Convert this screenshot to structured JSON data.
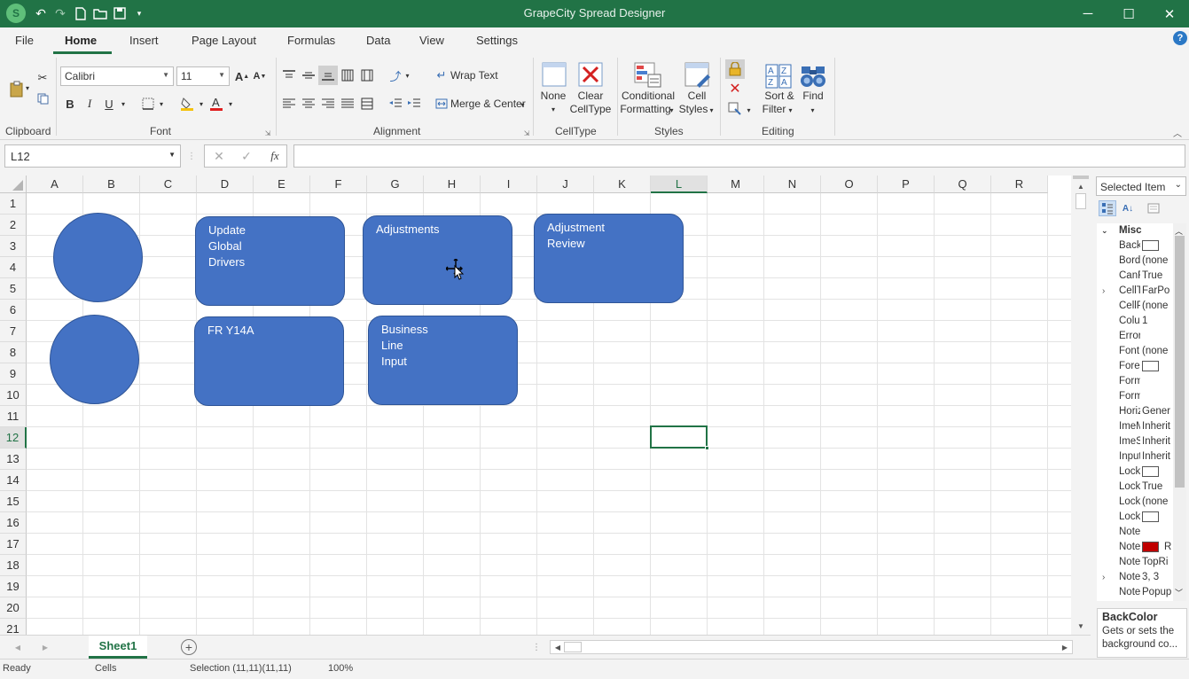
{
  "app": {
    "title": "GrapeCity Spread Designer"
  },
  "menu": {
    "tabs": [
      "File",
      "Home",
      "Insert",
      "Page Layout",
      "Formulas",
      "Data",
      "View",
      "Settings"
    ],
    "active": "Home"
  },
  "ribbon": {
    "font_name": "Calibri",
    "font_size": "11",
    "wrap_text": "Wrap Text",
    "merge_center": "Merge & Center",
    "none": "None",
    "clear_celltype_1": "Clear",
    "clear_celltype_2": "CellType",
    "conditional_1": "Conditional",
    "conditional_2": "Formatting",
    "cell_styles_1": "Cell",
    "cell_styles_2": "Styles",
    "sort_1": "Sort &",
    "sort_2": "Filter",
    "find": "Find",
    "bold": "B",
    "italic": "I",
    "underline": "U",
    "groups": {
      "clipboard": "Clipboard",
      "font": "Font",
      "alignment": "Alignment",
      "celltype": "CellType",
      "styles": "Styles",
      "editing": "Editing"
    }
  },
  "formula_bar": {
    "name_box": "L12",
    "fx": "fx",
    "formula": ""
  },
  "grid": {
    "columns": [
      "A",
      "B",
      "C",
      "D",
      "E",
      "F",
      "G",
      "H",
      "I",
      "J",
      "K",
      "L",
      "M",
      "N",
      "O",
      "P",
      "Q",
      "R"
    ],
    "rows": [
      "1",
      "2",
      "3",
      "4",
      "5",
      "6",
      "7",
      "8",
      "9",
      "10",
      "11",
      "12",
      "13",
      "14",
      "15",
      "16",
      "17",
      "18",
      "19",
      "20",
      "21"
    ],
    "selected_column": "L",
    "selected_row": "12"
  },
  "shapes": {
    "update_global": "Update\nGlobal\nDrivers",
    "adjustments": "Adjustments",
    "adjustment_review": "Adjustment\nReview",
    "fr_y14a": "FR Y14A",
    "business_line": "Business\nLine\nInput"
  },
  "sheet_tab": {
    "name": "Sheet1"
  },
  "status": {
    "ready": "Ready",
    "mode": "Cells",
    "selection": "Selection (11,11)(11,11)",
    "zoom": "100%"
  },
  "properties": {
    "selector": "Selected Item",
    "category": "Misc",
    "rows": [
      {
        "name": "BackColor",
        "value": "",
        "swatch": "#ffffff"
      },
      {
        "name": "Border",
        "value": "(none"
      },
      {
        "name": "CanFocus",
        "value": "True"
      },
      {
        "name": "CellType",
        "value": "FarPo",
        "expand": true
      },
      {
        "name": "CellPadding",
        "value": "(none"
      },
      {
        "name": "ColumnSpan",
        "value": "1"
      },
      {
        "name": "ErrorMessage",
        "value": ""
      },
      {
        "name": "Font",
        "value": "(none"
      },
      {
        "name": "ForeColor",
        "value": "",
        "swatch": "#ffffff"
      },
      {
        "name": "Formatter",
        "value": ""
      },
      {
        "name": "Formula",
        "value": ""
      },
      {
        "name": "HorizontalAlignment",
        "value": "Gener"
      },
      {
        "name": "ImeMode",
        "value": "Inherit"
      },
      {
        "name": "ImeSentenceMode",
        "value": "Inherit"
      },
      {
        "name": "InputScope",
        "value": "Inherit"
      },
      {
        "name": "Locked",
        "value": "",
        "swatch": "#ffffff"
      },
      {
        "name": "LockedBackColor",
        "value": "True"
      },
      {
        "name": "LockedFont",
        "value": "(none"
      },
      {
        "name": "LockedForeColor",
        "value": "",
        "swatch": "#ffffff"
      },
      {
        "name": "Note",
        "value": ""
      },
      {
        "name": "NoteIndicatorColor",
        "value": "R",
        "swatch": "#c00000"
      },
      {
        "name": "NoteIndicatorPosition",
        "value": "TopRi"
      },
      {
        "name": "NoteIndicatorSize",
        "value": "3, 3",
        "expand": true
      },
      {
        "name": "NoteStyle",
        "value": "Popup"
      }
    ],
    "desc_title": "BackColor",
    "desc_text": "Gets or sets the background co..."
  }
}
